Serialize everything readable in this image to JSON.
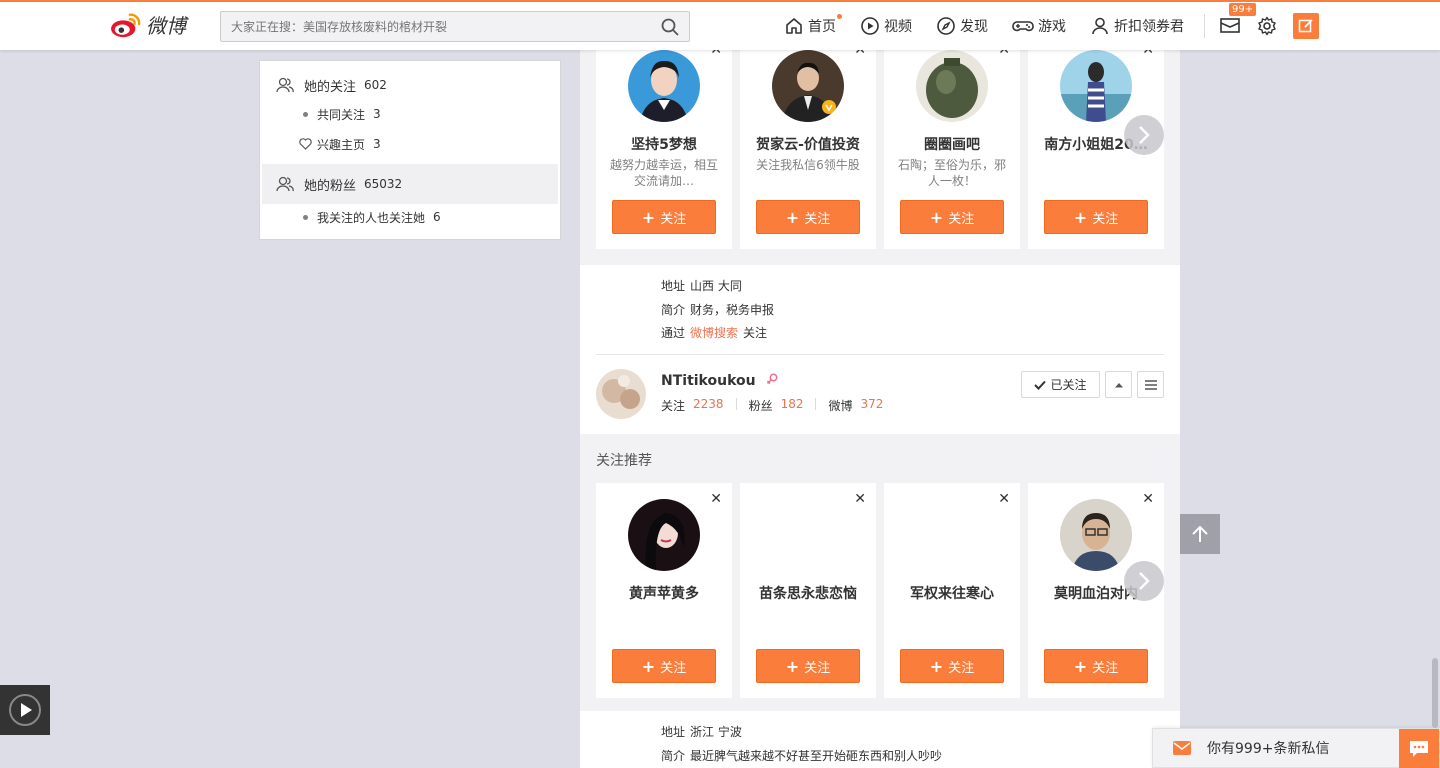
{
  "header": {
    "logo_text": "微博",
    "search_placeholder": "大家正在搜：美国存放核废料的棺材开裂",
    "nav": [
      {
        "label": "首页",
        "icon": "home-icon"
      },
      {
        "label": "视频",
        "icon": "video-icon"
      },
      {
        "label": "发现",
        "icon": "compass-icon"
      },
      {
        "label": "游戏",
        "icon": "gamepad-icon"
      },
      {
        "label": "折扣领券君",
        "icon": "user-icon"
      }
    ],
    "mail_badge": "99+"
  },
  "sidebar": {
    "following_label": "她的关注",
    "following_count": "602",
    "mutual_label": "共同关注",
    "mutual_count": "3",
    "interest_label": "兴趣主页",
    "interest_count": "3",
    "fans_label": "她的粉丝",
    "fans_count": "65032",
    "also_label": "我关注的人也关注她",
    "also_count": "6"
  },
  "rec_top": [
    {
      "name": "坚持5梦想",
      "desc": "越努力越幸运，相互交流请加…",
      "follow": "关注"
    },
    {
      "name": "贺家云-价值投资",
      "desc": "关注我私信6领牛股",
      "follow": "关注"
    },
    {
      "name": "圈圈画吧",
      "desc": "石陶；至俗为乐，邪人一枚！",
      "follow": "关注"
    },
    {
      "name": "南方小姐姐20…",
      "desc": "",
      "follow": "关注"
    }
  ],
  "info1": {
    "addr_k": "地址",
    "addr_v": "山西 大同",
    "intro_k": "简介",
    "intro_v": "财务，税务申报",
    "via_k": "通过",
    "via_link": "微博搜索",
    "via_tail": "关注"
  },
  "user": {
    "name": "NTitikoukou",
    "follow_k": "关注",
    "follow_v": "2238",
    "fans_k": "粉丝",
    "fans_v": "182",
    "weibo_k": "微博",
    "weibo_v": "372",
    "followed_btn": "已关注"
  },
  "rec_title": "关注推荐",
  "rec_bottom": [
    {
      "name": "黄声苹黄多",
      "follow": "关注"
    },
    {
      "name": "苗条思永悲恋恼",
      "follow": "关注"
    },
    {
      "name": "军权来往寒心",
      "follow": "关注"
    },
    {
      "name": "莫明血泊对内",
      "follow": "关注"
    }
  ],
  "info2": {
    "addr_k": "地址",
    "addr_v": "浙江 宁波",
    "intro_k": "简介",
    "intro_v": "最近脾气越来越不好甚至开始砸东西和别人吵吵"
  },
  "message_bar": "你有999+条新私信",
  "colors": {
    "accent": "#fa7d3c",
    "link": "#eb7350"
  }
}
